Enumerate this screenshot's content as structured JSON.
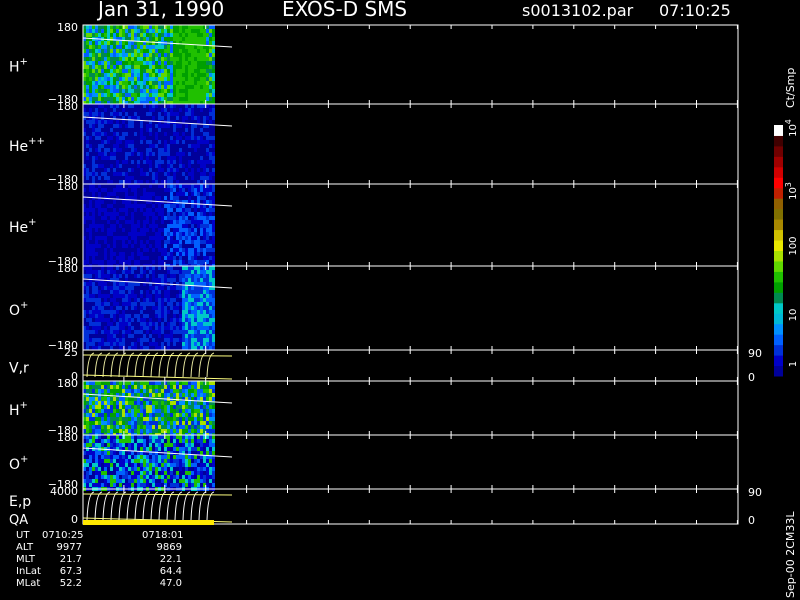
{
  "header": {
    "date": "Jan 31, 1990",
    "instrument": "EXOS-D SMS",
    "file": "s0013102.par",
    "time": "07:10:25"
  },
  "colorbar": {
    "unit": "Ct/Smp",
    "ticks": [
      {
        "base": "1",
        "exp": ""
      },
      {
        "base": "10",
        "exp": ""
      },
      {
        "base": "100",
        "exp": ""
      },
      {
        "base": "10",
        "exp": "3"
      },
      {
        "base": "10",
        "exp": "4"
      }
    ],
    "colors": [
      "#00009a",
      "#0000c8",
      "#0030d8",
      "#0060ff",
      "#0090ff",
      "#00b8d8",
      "#00c8c8",
      "#008a50",
      "#00a000",
      "#20c000",
      "#60d800",
      "#a8e000",
      "#e8e800",
      "#d0c000",
      "#a88800",
      "#807000",
      "#906000",
      "#c02000",
      "#ff0000",
      "#d00000",
      "#a00000",
      "#700000",
      "#400000",
      "#ffffff"
    ]
  },
  "footer_note": "Sep-00 2CM33L",
  "chart_data": {
    "type": "heatmap",
    "panels": [
      {
        "label": "H",
        "sup": "+",
        "ymax": "180",
        "ymin": "−180"
      },
      {
        "label": "He",
        "sup": "++",
        "ymax": "180",
        "ymin": "−180"
      },
      {
        "label": "He",
        "sup": "+",
        "ymax": "180",
        "ymin": "−180"
      },
      {
        "label": "O",
        "sup": "+",
        "ymax": "180",
        "ymin": "−180"
      },
      {
        "label": "V,r",
        "sup": "",
        "ymax": "25",
        "ymin": "0",
        "right_top": "90",
        "right_bottom": "0"
      },
      {
        "label": "H",
        "sup": "+",
        "ymax": "180",
        "ymin": "−180"
      },
      {
        "label": "O",
        "sup": "+",
        "ymax": "180",
        "ymin": "−180"
      },
      {
        "label": "E,p",
        "sup": "",
        "ymax": "4000",
        "ymin": "0",
        "right_top": "90",
        "right_bottom": "0"
      }
    ],
    "qa_label": "QA",
    "data_coverage": 0.2
  },
  "table": [
    {
      "label": "UT",
      "v0": "0710:25",
      "v1": "0718:01"
    },
    {
      "label": "ALT",
      "v0": "9977",
      "v1": "9869"
    },
    {
      "label": "MLT",
      "v0": "21.7",
      "v1": "22.1"
    },
    {
      "label": "InLat",
      "v0": "67.3",
      "v1": "64.4"
    },
    {
      "label": "MLat",
      "v0": "52.2",
      "v1": "47.0"
    }
  ]
}
